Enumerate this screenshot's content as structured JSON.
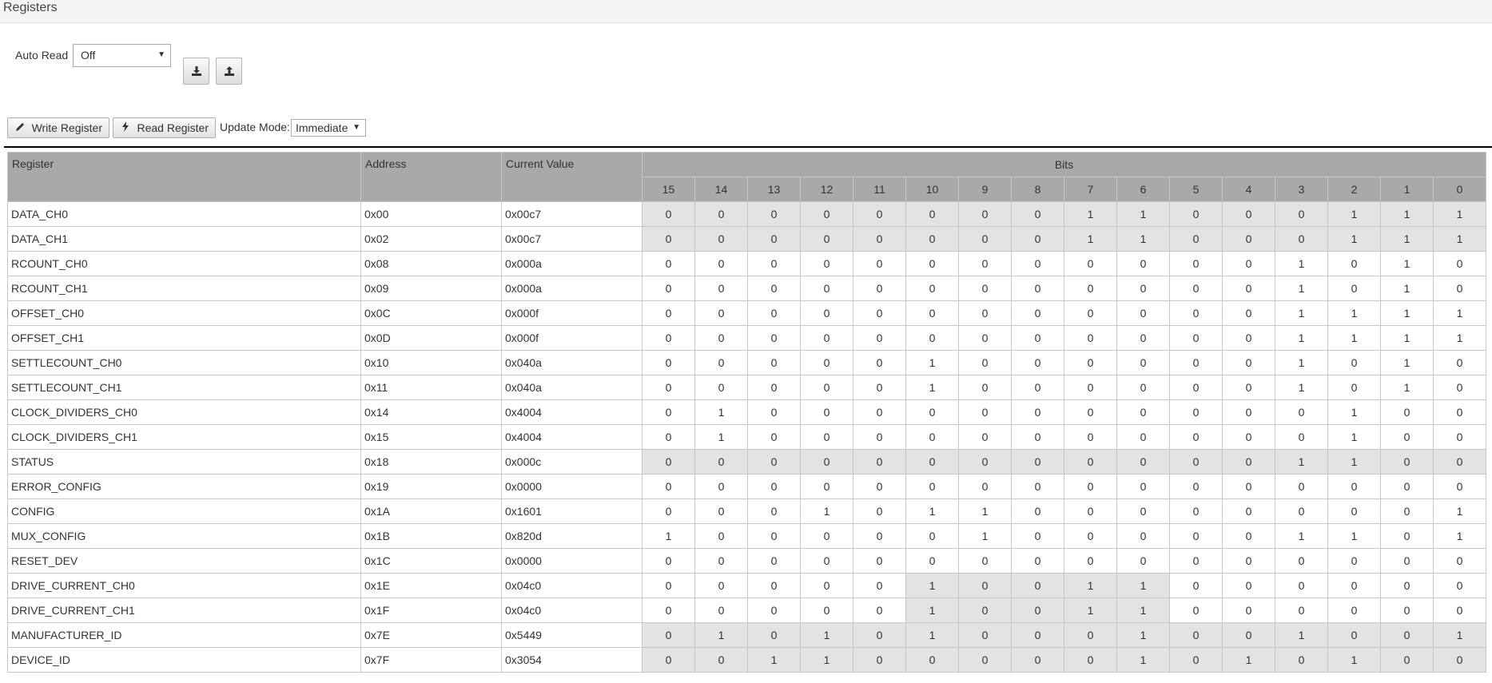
{
  "header": {
    "title": "Registers"
  },
  "controls": {
    "auto_read_label": "Auto Read",
    "auto_read_value": "Off",
    "write_register_label": "Write Register",
    "read_register_label": "Read Register",
    "update_mode_label": "Update Mode:",
    "update_mode_value": "Immediate",
    "icons": [
      "download-icon",
      "upload-icon",
      "pencil-icon",
      "bolt-icon",
      "caret-down-icon"
    ]
  },
  "table": {
    "headers": {
      "register": "Register",
      "address": "Address",
      "value": "Current Value",
      "bits": "Bits"
    },
    "bit_labels": [
      "15",
      "14",
      "13",
      "12",
      "11",
      "10",
      "9",
      "8",
      "7",
      "6",
      "5",
      "4",
      "3",
      "2",
      "1",
      "0"
    ],
    "rows": [
      {
        "name": "DATA_CH0",
        "address": "0x00",
        "value": "0x00c7",
        "bits": [
          "0",
          "0",
          "0",
          "0",
          "0",
          "0",
          "0",
          "0",
          "1",
          "1",
          "0",
          "0",
          "0",
          "1",
          "1",
          "1"
        ],
        "shade": "all"
      },
      {
        "name": "DATA_CH1",
        "address": "0x02",
        "value": "0x00c7",
        "bits": [
          "0",
          "0",
          "0",
          "0",
          "0",
          "0",
          "0",
          "0",
          "1",
          "1",
          "0",
          "0",
          "0",
          "1",
          "1",
          "1"
        ],
        "shade": "all"
      },
      {
        "name": "RCOUNT_CH0",
        "address": "0x08",
        "value": "0x000a",
        "bits": [
          "0",
          "0",
          "0",
          "0",
          "0",
          "0",
          "0",
          "0",
          "0",
          "0",
          "0",
          "0",
          "1",
          "0",
          "1",
          "0"
        ],
        "shade": "none"
      },
      {
        "name": "RCOUNT_CH1",
        "address": "0x09",
        "value": "0x000a",
        "bits": [
          "0",
          "0",
          "0",
          "0",
          "0",
          "0",
          "0",
          "0",
          "0",
          "0",
          "0",
          "0",
          "1",
          "0",
          "1",
          "0"
        ],
        "shade": "none"
      },
      {
        "name": "OFFSET_CH0",
        "address": "0x0C",
        "value": "0x000f",
        "bits": [
          "0",
          "0",
          "0",
          "0",
          "0",
          "0",
          "0",
          "0",
          "0",
          "0",
          "0",
          "0",
          "1",
          "1",
          "1",
          "1"
        ],
        "shade": "none"
      },
      {
        "name": "OFFSET_CH1",
        "address": "0x0D",
        "value": "0x000f",
        "bits": [
          "0",
          "0",
          "0",
          "0",
          "0",
          "0",
          "0",
          "0",
          "0",
          "0",
          "0",
          "0",
          "1",
          "1",
          "1",
          "1"
        ],
        "shade": "none"
      },
      {
        "name": "SETTLECOUNT_CH0",
        "address": "0x10",
        "value": "0x040a",
        "bits": [
          "0",
          "0",
          "0",
          "0",
          "0",
          "1",
          "0",
          "0",
          "0",
          "0",
          "0",
          "0",
          "1",
          "0",
          "1",
          "0"
        ],
        "shade": "none"
      },
      {
        "name": "SETTLECOUNT_CH1",
        "address": "0x11",
        "value": "0x040a",
        "bits": [
          "0",
          "0",
          "0",
          "0",
          "0",
          "1",
          "0",
          "0",
          "0",
          "0",
          "0",
          "0",
          "1",
          "0",
          "1",
          "0"
        ],
        "shade": "none"
      },
      {
        "name": "CLOCK_DIVIDERS_CH0",
        "address": "0x14",
        "value": "0x4004",
        "bits": [
          "0",
          "1",
          "0",
          "0",
          "0",
          "0",
          "0",
          "0",
          "0",
          "0",
          "0",
          "0",
          "0",
          "1",
          "0",
          "0"
        ],
        "shade": "none"
      },
      {
        "name": "CLOCK_DIVIDERS_CH1",
        "address": "0x15",
        "value": "0x4004",
        "bits": [
          "0",
          "1",
          "0",
          "0",
          "0",
          "0",
          "0",
          "0",
          "0",
          "0",
          "0",
          "0",
          "0",
          "1",
          "0",
          "0"
        ],
        "shade": "none"
      },
      {
        "name": "STATUS",
        "address": "0x18",
        "value": "0x000c",
        "bits": [
          "0",
          "0",
          "0",
          "0",
          "0",
          "0",
          "0",
          "0",
          "0",
          "0",
          "0",
          "0",
          "1",
          "1",
          "0",
          "0"
        ],
        "shade": "all"
      },
      {
        "name": "ERROR_CONFIG",
        "address": "0x19",
        "value": "0x0000",
        "bits": [
          "0",
          "0",
          "0",
          "0",
          "0",
          "0",
          "0",
          "0",
          "0",
          "0",
          "0",
          "0",
          "0",
          "0",
          "0",
          "0"
        ],
        "shade": "none"
      },
      {
        "name": "CONFIG",
        "address": "0x1A",
        "value": "0x1601",
        "bits": [
          "0",
          "0",
          "0",
          "1",
          "0",
          "1",
          "1",
          "0",
          "0",
          "0",
          "0",
          "0",
          "0",
          "0",
          "0",
          "1"
        ],
        "shade": "none"
      },
      {
        "name": "MUX_CONFIG",
        "address": "0x1B",
        "value": "0x820d",
        "bits": [
          "1",
          "0",
          "0",
          "0",
          "0",
          "0",
          "1",
          "0",
          "0",
          "0",
          "0",
          "0",
          "1",
          "1",
          "0",
          "1"
        ],
        "shade": "none"
      },
      {
        "name": "RESET_DEV",
        "address": "0x1C",
        "value": "0x0000",
        "bits": [
          "0",
          "0",
          "0",
          "0",
          "0",
          "0",
          "0",
          "0",
          "0",
          "0",
          "0",
          "0",
          "0",
          "0",
          "0",
          "0"
        ],
        "shade": "none"
      },
      {
        "name": "DRIVE_CURRENT_CH0",
        "address": "0x1E",
        "value": "0x04c0",
        "bits": [
          "0",
          "0",
          "0",
          "0",
          "0",
          "1",
          "0",
          "0",
          "1",
          "1",
          "0",
          "0",
          "0",
          "0",
          "0",
          "0"
        ],
        "shade": "partial"
      },
      {
        "name": "DRIVE_CURRENT_CH1",
        "address": "0x1F",
        "value": "0x04c0",
        "bits": [
          "0",
          "0",
          "0",
          "0",
          "0",
          "1",
          "0",
          "0",
          "1",
          "1",
          "0",
          "0",
          "0",
          "0",
          "0",
          "0"
        ],
        "shade": "partial"
      },
      {
        "name": "MANUFACTURER_ID",
        "address": "0x7E",
        "value": "0x5449",
        "bits": [
          "0",
          "1",
          "0",
          "1",
          "0",
          "1",
          "0",
          "0",
          "0",
          "1",
          "0",
          "0",
          "1",
          "0",
          "0",
          "1"
        ],
        "shade": "all"
      },
      {
        "name": "DEVICE_ID",
        "address": "0x7F",
        "value": "0x3054",
        "bits": [
          "0",
          "0",
          "1",
          "1",
          "0",
          "0",
          "0",
          "0",
          "0",
          "1",
          "0",
          "1",
          "0",
          "1",
          "0",
          "0"
        ],
        "shade": "all"
      }
    ]
  }
}
